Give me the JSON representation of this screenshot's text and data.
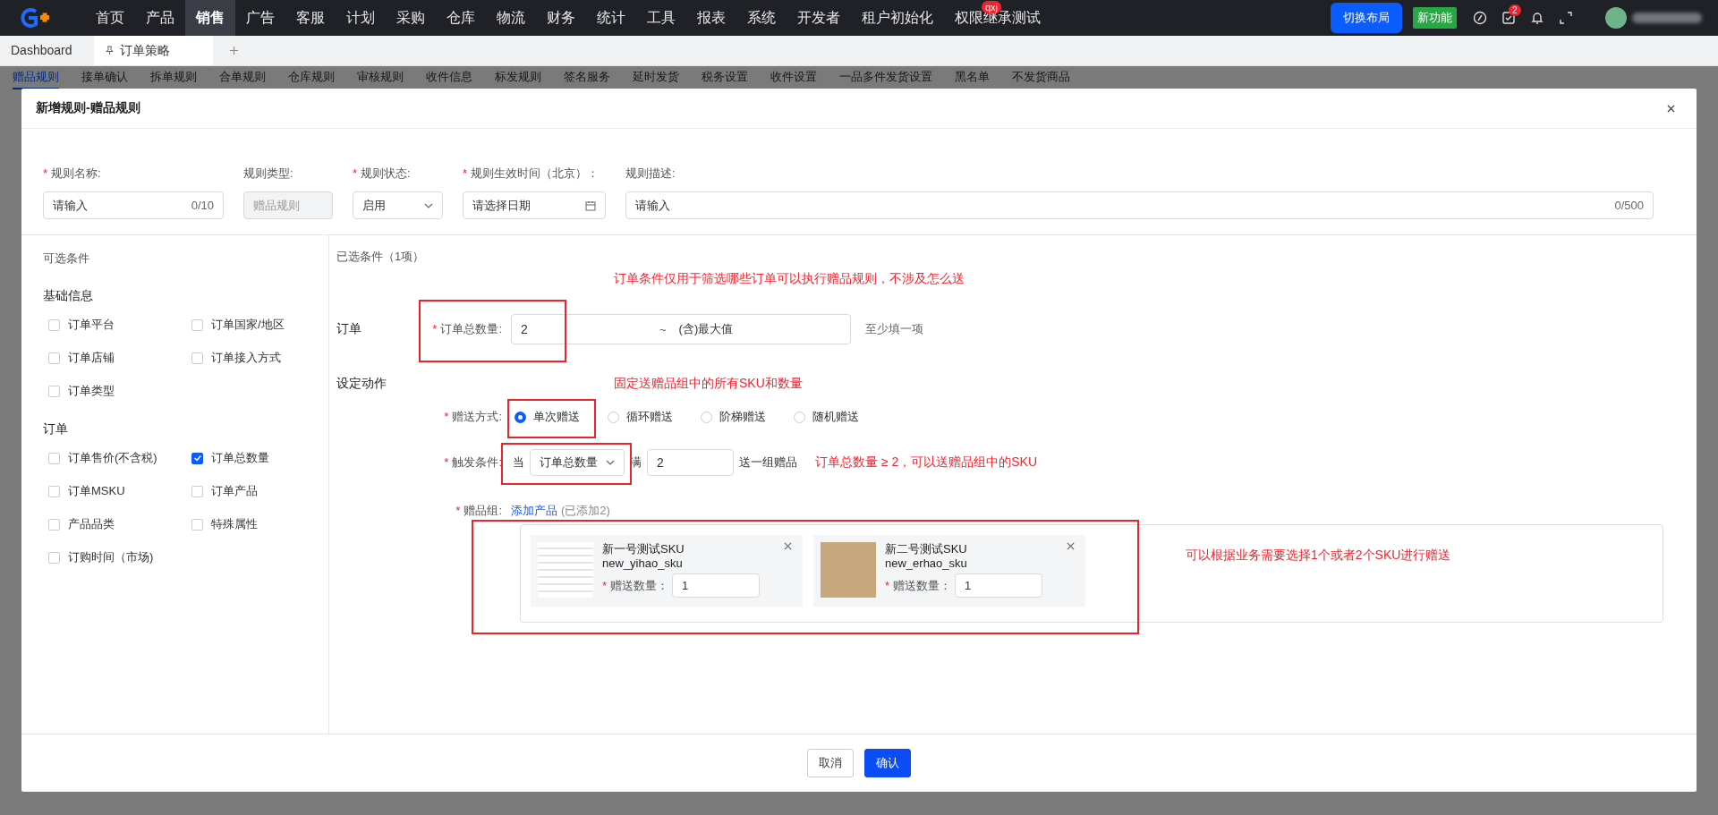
{
  "nav": {
    "items": [
      {
        "label": "首页",
        "selected": false
      },
      {
        "label": "产品",
        "selected": false
      },
      {
        "label": "销售",
        "selected": true
      },
      {
        "label": "广告",
        "selected": false
      },
      {
        "label": "客服",
        "selected": false
      },
      {
        "label": "计划",
        "selected": false
      },
      {
        "label": "采购",
        "selected": false
      },
      {
        "label": "仓库",
        "selected": false
      },
      {
        "label": "物流",
        "selected": false
      },
      {
        "label": "财务",
        "selected": false
      },
      {
        "label": "统计",
        "selected": false
      },
      {
        "label": "工具",
        "selected": false
      },
      {
        "label": "报表",
        "selected": false
      },
      {
        "label": "系统",
        "selected": false
      },
      {
        "label": "开发者",
        "selected": false
      },
      {
        "label": "租户初始化",
        "selected": false
      },
      {
        "label": "权限继承测试",
        "selected": false,
        "badge": "qxj"
      }
    ],
    "switch_layout": "切换布局",
    "new_feature": "新功能",
    "task_badge": "2"
  },
  "tabs": [
    {
      "label": "Dashboard",
      "selected": false,
      "pinned": false
    },
    {
      "label": "订单策略",
      "selected": true,
      "pinned": true
    }
  ],
  "sub_tabs": [
    {
      "label": "赠品规则",
      "selected": true
    },
    {
      "label": "接单确认",
      "selected": false
    },
    {
      "label": "拆单规则",
      "selected": false
    },
    {
      "label": "合单规则",
      "selected": false
    },
    {
      "label": "仓库规则",
      "selected": false
    },
    {
      "label": "审核规则",
      "selected": false
    },
    {
      "label": "收件信息",
      "selected": false
    },
    {
      "label": "标发规则",
      "selected": false
    },
    {
      "label": "签名服务",
      "selected": false
    },
    {
      "label": "延时发货",
      "selected": false
    },
    {
      "label": "税务设置",
      "selected": false
    },
    {
      "label": "收件设置",
      "selected": false
    },
    {
      "label": "一品多件发货设置",
      "selected": false
    },
    {
      "label": "黑名单",
      "selected": false
    },
    {
      "label": "不发货商品",
      "selected": false
    }
  ],
  "dialog": {
    "title": "新增规则-赠品规则",
    "fields": [
      {
        "kind": "text",
        "label": "规则名称:",
        "required_mark": "*",
        "placeholder": "请输入",
        "counter": "0/10"
      },
      {
        "kind": "readonly",
        "label": "规则类型:",
        "value": "赠品规则"
      },
      {
        "kind": "select",
        "label": "规则状态:",
        "required_mark": "*",
        "value": "启用"
      },
      {
        "kind": "date",
        "label": "规则生效时间（北京）：",
        "required_mark": "*",
        "placeholder": "请选择日期"
      },
      {
        "kind": "text",
        "label": "规则描述:",
        "placeholder": "请输入",
        "counter": "0/500"
      }
    ],
    "available": {
      "title": "可选条件",
      "groups": [
        {
          "title": "基础信息",
          "options": [
            {
              "label": "订单平台",
              "checked": false
            },
            {
              "label": "订单国家/地区",
              "checked": false
            },
            {
              "label": "订单店铺",
              "checked": false
            },
            {
              "label": "订单接入方式",
              "checked": false
            },
            {
              "label": "订单类型",
              "checked": false
            }
          ]
        },
        {
          "title": "订单",
          "options": [
            {
              "label": "订单售价(不含税)",
              "checked": false
            },
            {
              "label": "订单总数量",
              "checked": true
            },
            {
              "label": "订单MSKU",
              "checked": false
            },
            {
              "label": "订单产品",
              "checked": false
            },
            {
              "label": "产品品类",
              "checked": false
            },
            {
              "label": "特殊属性",
              "checked": false
            },
            {
              "label": "订购时间（市场)",
              "checked": false
            }
          ]
        }
      ]
    },
    "chosen": {
      "title": "已选条件（1项）",
      "order": {
        "title": "订单",
        "note": "订单条件仅用于筛选哪些订单可以执行赠品规则，不涉及怎么送",
        "label": "订单总数量:",
        "required_mark": "*",
        "min_value": "2",
        "separator": "~",
        "max_placeholder": "(含)最大值",
        "hint": "至少填一项"
      },
      "action": {
        "title": "设定动作",
        "note": "固定送赠品组中的所有SKU和数量",
        "mode": {
          "label": "赠送方式:",
          "required_mark": "*",
          "options": [
            {
              "label": "单次赠送",
              "selected": true
            },
            {
              "label": "循环赠送",
              "selected": false
            },
            {
              "label": "阶梯赠送",
              "selected": false
            },
            {
              "label": "随机赠送",
              "selected": false
            }
          ]
        },
        "trigger": {
          "label": "触发条件:",
          "required_mark": "*",
          "prefix": "当",
          "select_value": "订单总数量",
          "middle": "满",
          "value": "2",
          "suffix": "送一组赠品",
          "note": "订单总数量 ≥ 2，可以送赠品组中的SKU"
        },
        "gifts": {
          "label": "赠品组:",
          "required_mark": "*",
          "add_link": "添加产品",
          "added": "(已添加2)",
          "note": "可以根据业务需要选择1个或者2个SKU进行赠送",
          "products": [
            {
              "kind": "screenshot",
              "name": "新一号测试SKU",
              "sku": "new_yihao_sku",
              "required_mark": "*",
              "qty_label": "赠送数量：",
              "qty": "1"
            },
            {
              "kind": "photo",
              "name": "新二号测试SKU",
              "sku": "new_erhao_sku",
              "required_mark": "*",
              "qty_label": "赠送数量：",
              "qty": "1"
            }
          ]
        }
      }
    },
    "buttons": [
      {
        "label": "取消",
        "primary": false
      },
      {
        "label": "确认",
        "primary": true
      }
    ]
  }
}
